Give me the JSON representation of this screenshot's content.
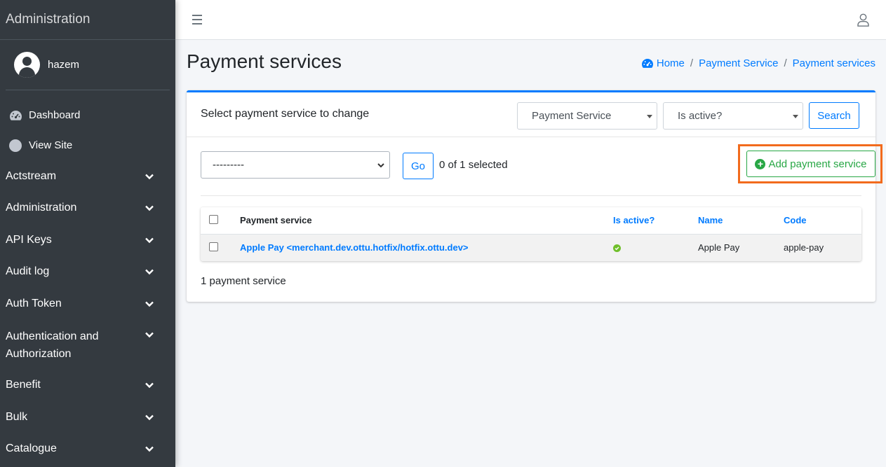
{
  "sidebar": {
    "brand": "Administration",
    "user_name": "hazem",
    "top_links": [
      {
        "label": "Dashboard",
        "icon": "tachometer-icon"
      },
      {
        "label": "View Site",
        "icon": "circle-icon"
      }
    ],
    "groups": [
      {
        "label": "Actstream"
      },
      {
        "label": "Administration"
      },
      {
        "label": "API Keys"
      },
      {
        "label": "Audit log"
      },
      {
        "label": "Auth Token"
      },
      {
        "label": "Authentication and Authorization"
      },
      {
        "label": "Benefit"
      },
      {
        "label": "Bulk"
      },
      {
        "label": "Catalogue"
      }
    ]
  },
  "topbar": {
    "menu_icon": "hamburger-icon",
    "user_icon": "user-icon"
  },
  "page": {
    "title": "Payment services",
    "breadcrumb": [
      "Home",
      "Payment Service",
      "Payment services"
    ]
  },
  "card": {
    "title": "Select payment service to change",
    "filter_service": "Payment Service",
    "filter_active": "Is active?",
    "search_label": "Search",
    "action_value": "---------",
    "go_label": "Go",
    "selection_counter": "0 of 1 selected",
    "add_label": "Add payment service",
    "result_count": "1 payment service"
  },
  "table": {
    "headers": [
      "Payment service",
      "Is active?",
      "Name",
      "Code"
    ],
    "rows": [
      {
        "payment_service": "Apple Pay <merchant.dev.ottu.hotfix/hotfix.ottu.dev>",
        "is_active": true,
        "name": "Apple Pay",
        "code": "apple-pay"
      }
    ]
  },
  "colors": {
    "accent": "#007bff",
    "success": "#28a745",
    "highlight": "#f26b1d",
    "sidebar": "#343a40"
  }
}
